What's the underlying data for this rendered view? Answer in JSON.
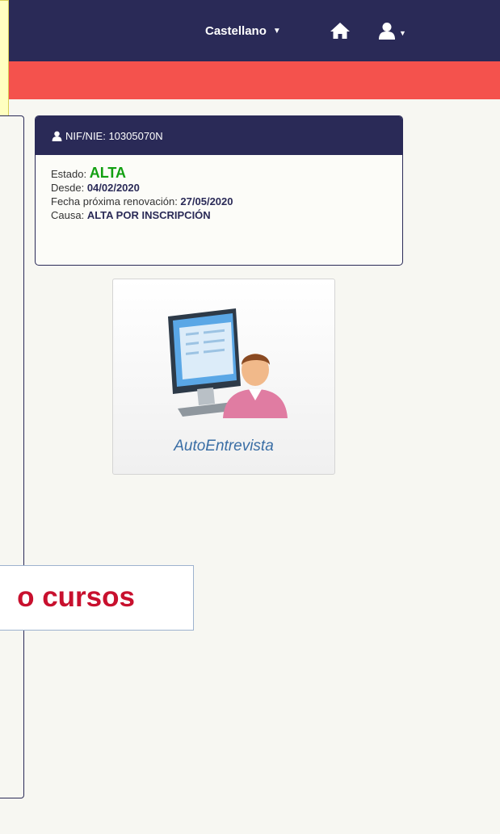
{
  "nav": {
    "language_label": "Castellano",
    "icons": [
      "home-icon",
      "user-icon"
    ]
  },
  "card": {
    "header_text": "NIF/NIE: 10305070N",
    "estado_label": "Estado: ",
    "estado_value": "ALTA",
    "desde_label": "Desde: ",
    "desde_value": "04/02/2020",
    "renovacion_label": "Fecha próxima renovación: ",
    "renovacion_value": "27/05/2020",
    "causa_label": "Causa: ",
    "causa_value": "ALTA POR INSCRIPCIÓN"
  },
  "tile": {
    "label": "AutoEntrevista"
  },
  "banner": {
    "text": "o cursos"
  },
  "colors": {
    "nav_bg": "#2a2a57",
    "red_bar": "#f4524d",
    "alta_green": "#12a012",
    "banner_red": "#c8102e"
  }
}
